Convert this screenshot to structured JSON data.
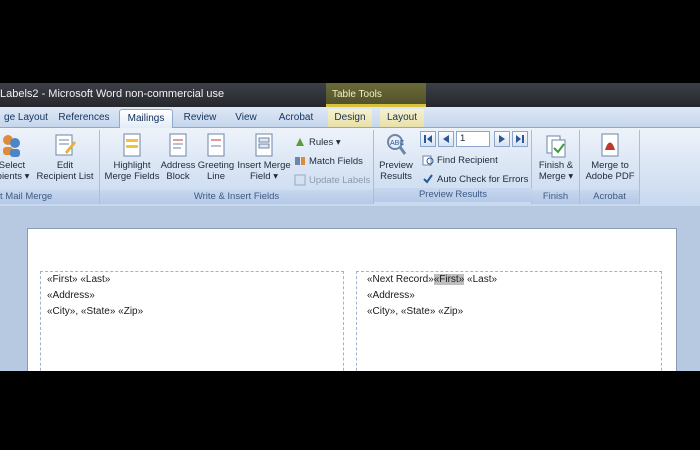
{
  "window": {
    "title": "Labels2 - Microsoft Word non-commercial use",
    "context_tab_group": "Table Tools"
  },
  "tabs": [
    {
      "label": "ge Layout"
    },
    {
      "label": "References"
    },
    {
      "label": "Mailings",
      "active": true
    },
    {
      "label": "Review"
    },
    {
      "label": "View"
    },
    {
      "label": "Acrobat"
    },
    {
      "label": "Design"
    },
    {
      "label": "Layout"
    }
  ],
  "ribbon": {
    "start_group": {
      "label": "t Mail Merge",
      "select_recipients_line1": "Select",
      "select_recipients_line2": "ipients",
      "edit_list_line1": "Edit",
      "edit_list_line2": "Recipient List"
    },
    "write_group": {
      "label": "Write & Insert Fields",
      "highlight_line1": "Highlight",
      "highlight_line2": "Merge Fields",
      "address_line1": "Address",
      "address_line2": "Block",
      "greeting_line1": "Greeting",
      "greeting_line2": "Line",
      "insert_line1": "Insert Merge",
      "insert_line2": "Field",
      "rules": "Rules",
      "match_fields": "Match Fields",
      "update_labels": "Update Labels"
    },
    "preview_group": {
      "label": "Preview Results",
      "preview_line1": "Preview",
      "preview_line2": "Results",
      "record_number": "1",
      "find_recipient": "Find Recipient",
      "auto_check": "Auto Check for Errors"
    },
    "finish_group": {
      "label": "Finish",
      "finish_line1": "Finish &",
      "finish_line2": "Merge"
    },
    "acrobat_group": {
      "label": "Acrobat",
      "merge_pdf_line1": "Merge to",
      "merge_pdf_line2": "Adobe PDF"
    }
  },
  "document": {
    "label1": {
      "line1": "«First» «Last»",
      "line2": "«Address»",
      "line3": "«City», «State» «Zip»"
    },
    "label2": {
      "next_record": "«Next Record»",
      "first_field": "«First»",
      "last_field": " «Last»",
      "line2": "«Address»",
      "line3": "«City», «State» «Zip»"
    }
  },
  "colors": {
    "accent": "#2b5797",
    "context_tab": "#d7c23b",
    "ribbon_bg": "#d6e3f3"
  }
}
